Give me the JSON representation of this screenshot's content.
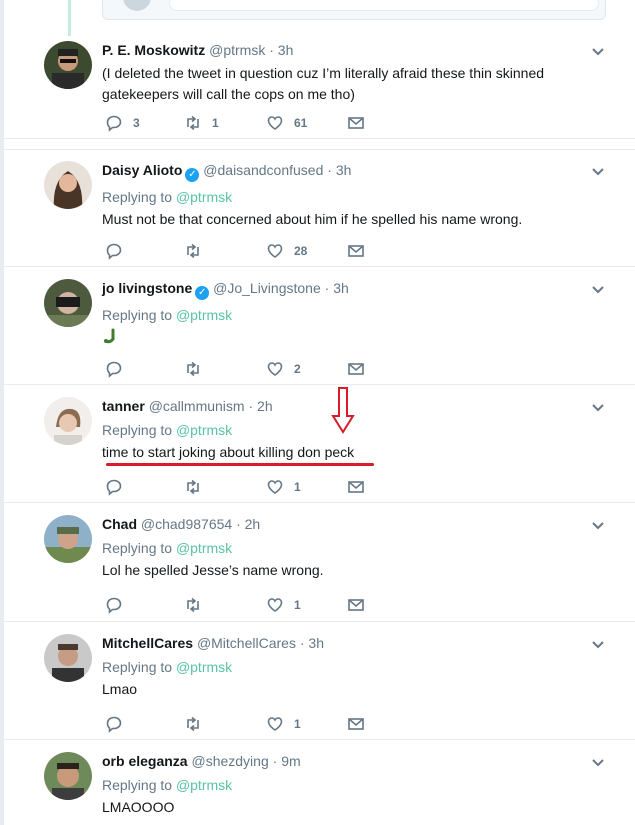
{
  "tweets": [
    {
      "name": "P. E. Moskowitz",
      "handle": "@ptrmsk",
      "time": "3h",
      "verified": false,
      "replying_prefix": "",
      "replying_to": "",
      "text": "(I deleted the tweet in question cuz I’m literally afraid these thin skinned gatekeepers will call the cops on me tho)",
      "reply_count": "3",
      "retweet_count": "1",
      "like_count": "61"
    },
    {
      "name": "Daisy Alioto",
      "handle": "@daisandconfused",
      "time": "3h",
      "verified": true,
      "replying_prefix": "Replying to",
      "replying_to": "@ptrmsk",
      "text": "Must not be that concerned about him if he spelled his name wrong.",
      "reply_count": "",
      "retweet_count": "",
      "like_count": "28"
    },
    {
      "name": "jo livingstone",
      "handle": "@Jo_Livingstone",
      "time": "3h",
      "verified": true,
      "replying_prefix": "Replying to",
      "replying_to": "@ptrmsk",
      "text": "",
      "reply_count": "",
      "retweet_count": "",
      "like_count": "2"
    },
    {
      "name": "tanner",
      "handle": "@callmmunism",
      "time": "2h",
      "verified": false,
      "replying_prefix": "Replying to",
      "replying_to": "@ptrmsk",
      "text": "time to start joking about killing don peck",
      "reply_count": "",
      "retweet_count": "",
      "like_count": "1"
    },
    {
      "name": "Chad",
      "handle": "@chad987654",
      "time": "2h",
      "verified": false,
      "replying_prefix": "Replying to",
      "replying_to": "@ptrmsk",
      "text": "Lol he spelled Jesse’s name wrong.",
      "reply_count": "",
      "retweet_count": "",
      "like_count": "1"
    },
    {
      "name": "MitchellCares",
      "handle": "@MitchellCares",
      "time": "3h",
      "verified": false,
      "replying_prefix": "Replying to",
      "replying_to": "@ptrmsk",
      "text": "Lmao",
      "reply_count": "",
      "retweet_count": "",
      "like_count": "1"
    },
    {
      "name": "orb eleganza",
      "handle": "@shezdying",
      "time": "9m",
      "verified": false,
      "replying_prefix": "Replying to",
      "replying_to": "@ptrmsk",
      "text": "LMAOOOO",
      "reply_count": "",
      "retweet_count": "",
      "like_count": ""
    }
  ],
  "colors": {
    "mention": "#59c3a5",
    "annotation_red": "#d81c2a",
    "verified": "#1da1f2",
    "muted": "#657786"
  },
  "icons": [
    "reply-icon",
    "retweet-icon",
    "like-icon",
    "message-icon",
    "chevron-down-icon",
    "verified-icon",
    "arrow-down-annotation",
    "emoji-icon"
  ]
}
